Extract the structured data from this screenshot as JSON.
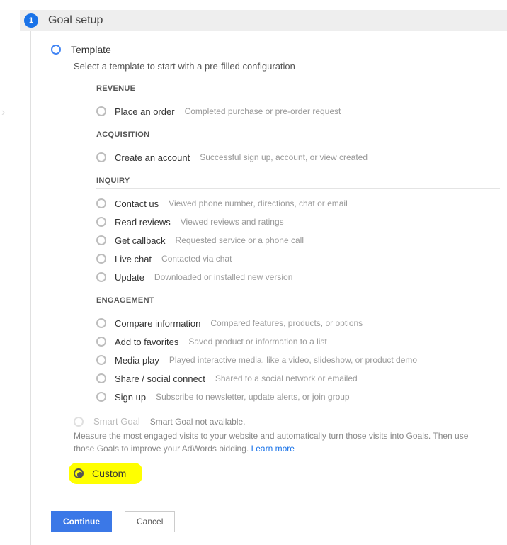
{
  "step": {
    "number": "1",
    "title": "Goal setup"
  },
  "template_option": {
    "label": "Template",
    "help": "Select a template to start with a pre-filled configuration"
  },
  "groups": [
    {
      "title": "REVENUE",
      "options": [
        {
          "label": "Place an order",
          "desc": "Completed purchase or pre-order request"
        }
      ]
    },
    {
      "title": "ACQUISITION",
      "options": [
        {
          "label": "Create an account",
          "desc": "Successful sign up, account, or view created"
        }
      ]
    },
    {
      "title": "INQUIRY",
      "options": [
        {
          "label": "Contact us",
          "desc": "Viewed phone number, directions, chat or email"
        },
        {
          "label": "Read reviews",
          "desc": "Viewed reviews and ratings"
        },
        {
          "label": "Get callback",
          "desc": "Requested service or a phone call"
        },
        {
          "label": "Live chat",
          "desc": "Contacted via chat"
        },
        {
          "label": "Update",
          "desc": "Downloaded or installed new version"
        }
      ]
    },
    {
      "title": "ENGAGEMENT",
      "options": [
        {
          "label": "Compare information",
          "desc": "Compared features, products, or options"
        },
        {
          "label": "Add to favorites",
          "desc": "Saved product or information to a list"
        },
        {
          "label": "Media play",
          "desc": "Played interactive media, like a video, slideshow, or product demo"
        },
        {
          "label": "Share / social connect",
          "desc": "Shared to a social network or emailed"
        },
        {
          "label": "Sign up",
          "desc": "Subscribe to newsletter, update alerts, or join group"
        }
      ]
    }
  ],
  "smart": {
    "label": "Smart Goal",
    "status": "Smart Goal not available.",
    "desc": "Measure the most engaged visits to your website and automatically turn those visits into Goals. Then use those Goals to improve your AdWords bidding. ",
    "link": "Learn more"
  },
  "custom": {
    "label": "Custom"
  },
  "buttons": {
    "continue": "Continue",
    "cancel": "Cancel"
  }
}
